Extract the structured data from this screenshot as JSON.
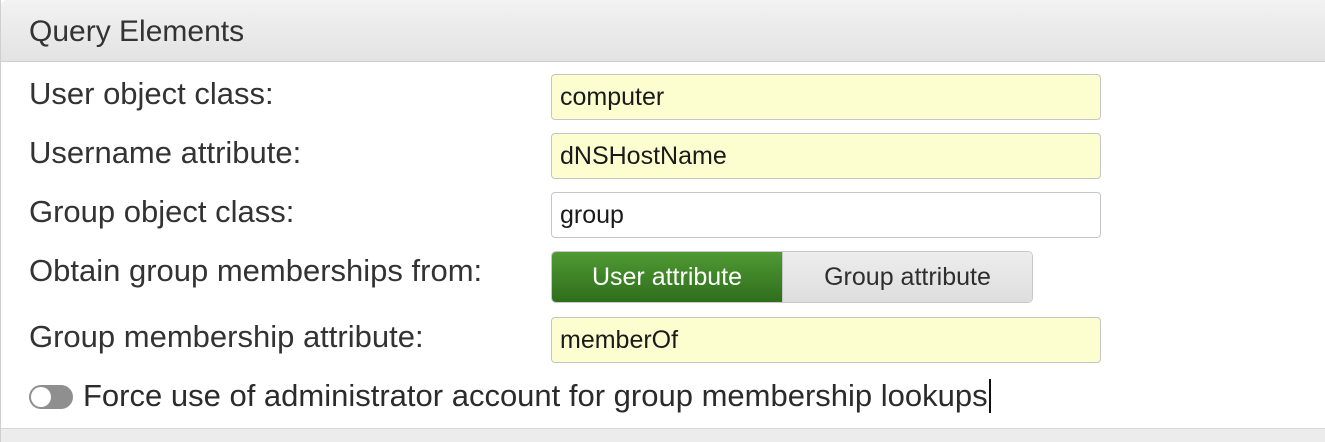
{
  "section": {
    "title": "Query Elements"
  },
  "fields": {
    "user_object_class": {
      "label": "User object class:",
      "value": "computer"
    },
    "username_attribute": {
      "label": "Username attribute:",
      "value": "dNSHostName"
    },
    "group_object_class": {
      "label": "Group object class:",
      "value": "group"
    },
    "group_membership_attribute": {
      "label": "Group membership attribute:",
      "value": "memberOf"
    }
  },
  "membership_source": {
    "label": "Obtain group memberships from:",
    "options": [
      "User attribute",
      "Group attribute"
    ],
    "selected": "User attribute"
  },
  "force_admin": {
    "label": "Force use of administrator account for group membership lookups",
    "enabled": false
  },
  "colors": {
    "highlight_field": "#fcfed0",
    "active_segment": "#3f842a",
    "toggle_off": "#8f8f8f"
  }
}
